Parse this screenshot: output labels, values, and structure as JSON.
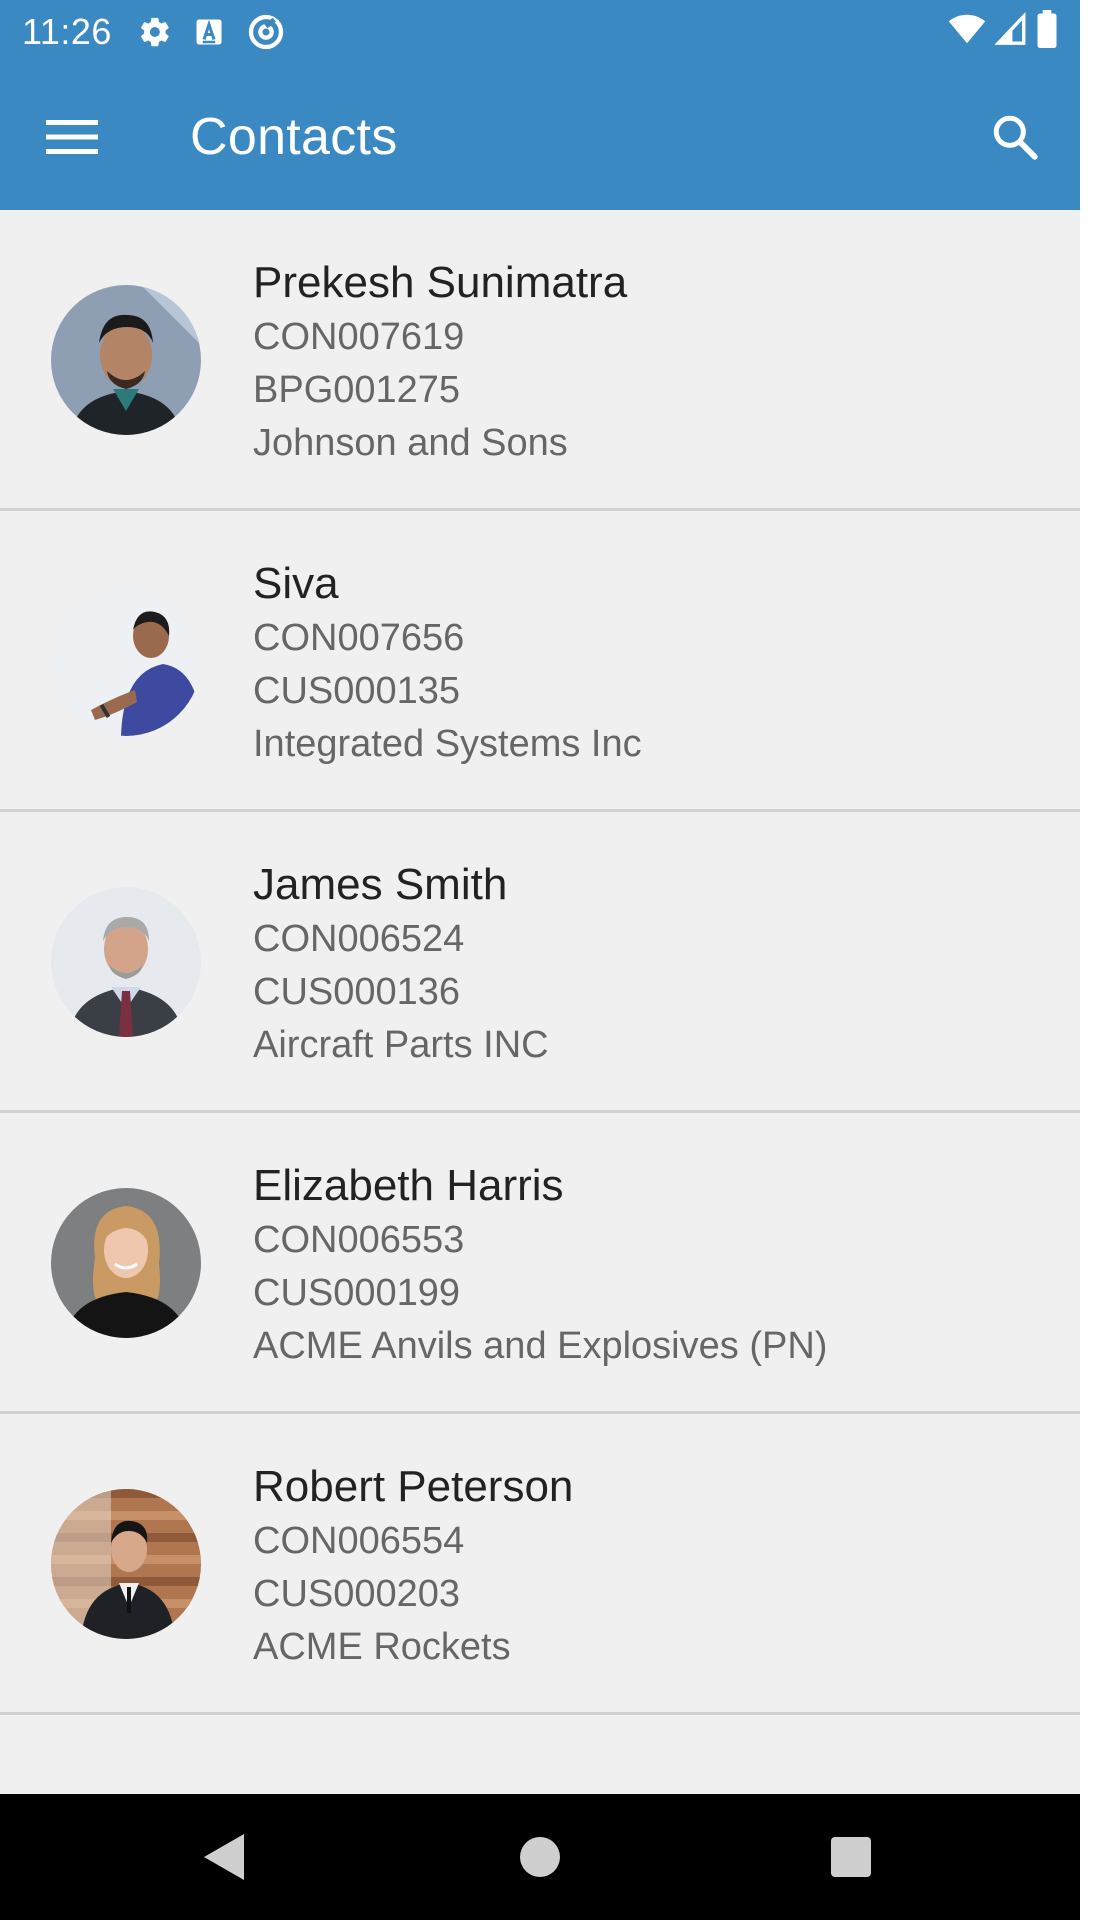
{
  "status_bar": {
    "time": "11:26",
    "left_icons": [
      "gear-icon",
      "a-box-icon",
      "at-sign-icon"
    ],
    "right_icons": [
      "wifi-icon",
      "cell-signal-icon",
      "battery-icon"
    ]
  },
  "app_bar": {
    "title": "Contacts",
    "menu_icon": "hamburger-menu-icon",
    "search_icon": "search-icon",
    "color": "#3a89c3"
  },
  "contacts": [
    {
      "name": "Prekesh Sunimatra",
      "contact_id": "CON007619",
      "account_id": "BPG001275",
      "company": "Johnson and Sons",
      "avatar": "man-portrait-photo"
    },
    {
      "name": "Siva",
      "contact_id": "CON007656",
      "account_id": "CUS000135",
      "company": "Integrated Systems Inc",
      "avatar": "man-writing-photo"
    },
    {
      "name": "James Smith",
      "contact_id": "CON006524",
      "account_id": "CUS000136",
      "company": "Aircraft Parts INC",
      "avatar": "gray-haired-man-suit-photo"
    },
    {
      "name": "Elizabeth Harris",
      "contact_id": "CON006553",
      "account_id": "CUS000199",
      "company": "ACME Anvils and Explosives (PN)",
      "avatar": "woman-portrait-photo"
    },
    {
      "name": "Robert Peterson",
      "contact_id": "CON006554",
      "account_id": "CUS000203",
      "company": "ACME Rockets",
      "avatar": "man-suit-wood-wall-photo"
    }
  ],
  "nav_bar": {
    "icons": [
      "back-triangle-icon",
      "home-circle-icon",
      "recents-square-icon"
    ]
  }
}
